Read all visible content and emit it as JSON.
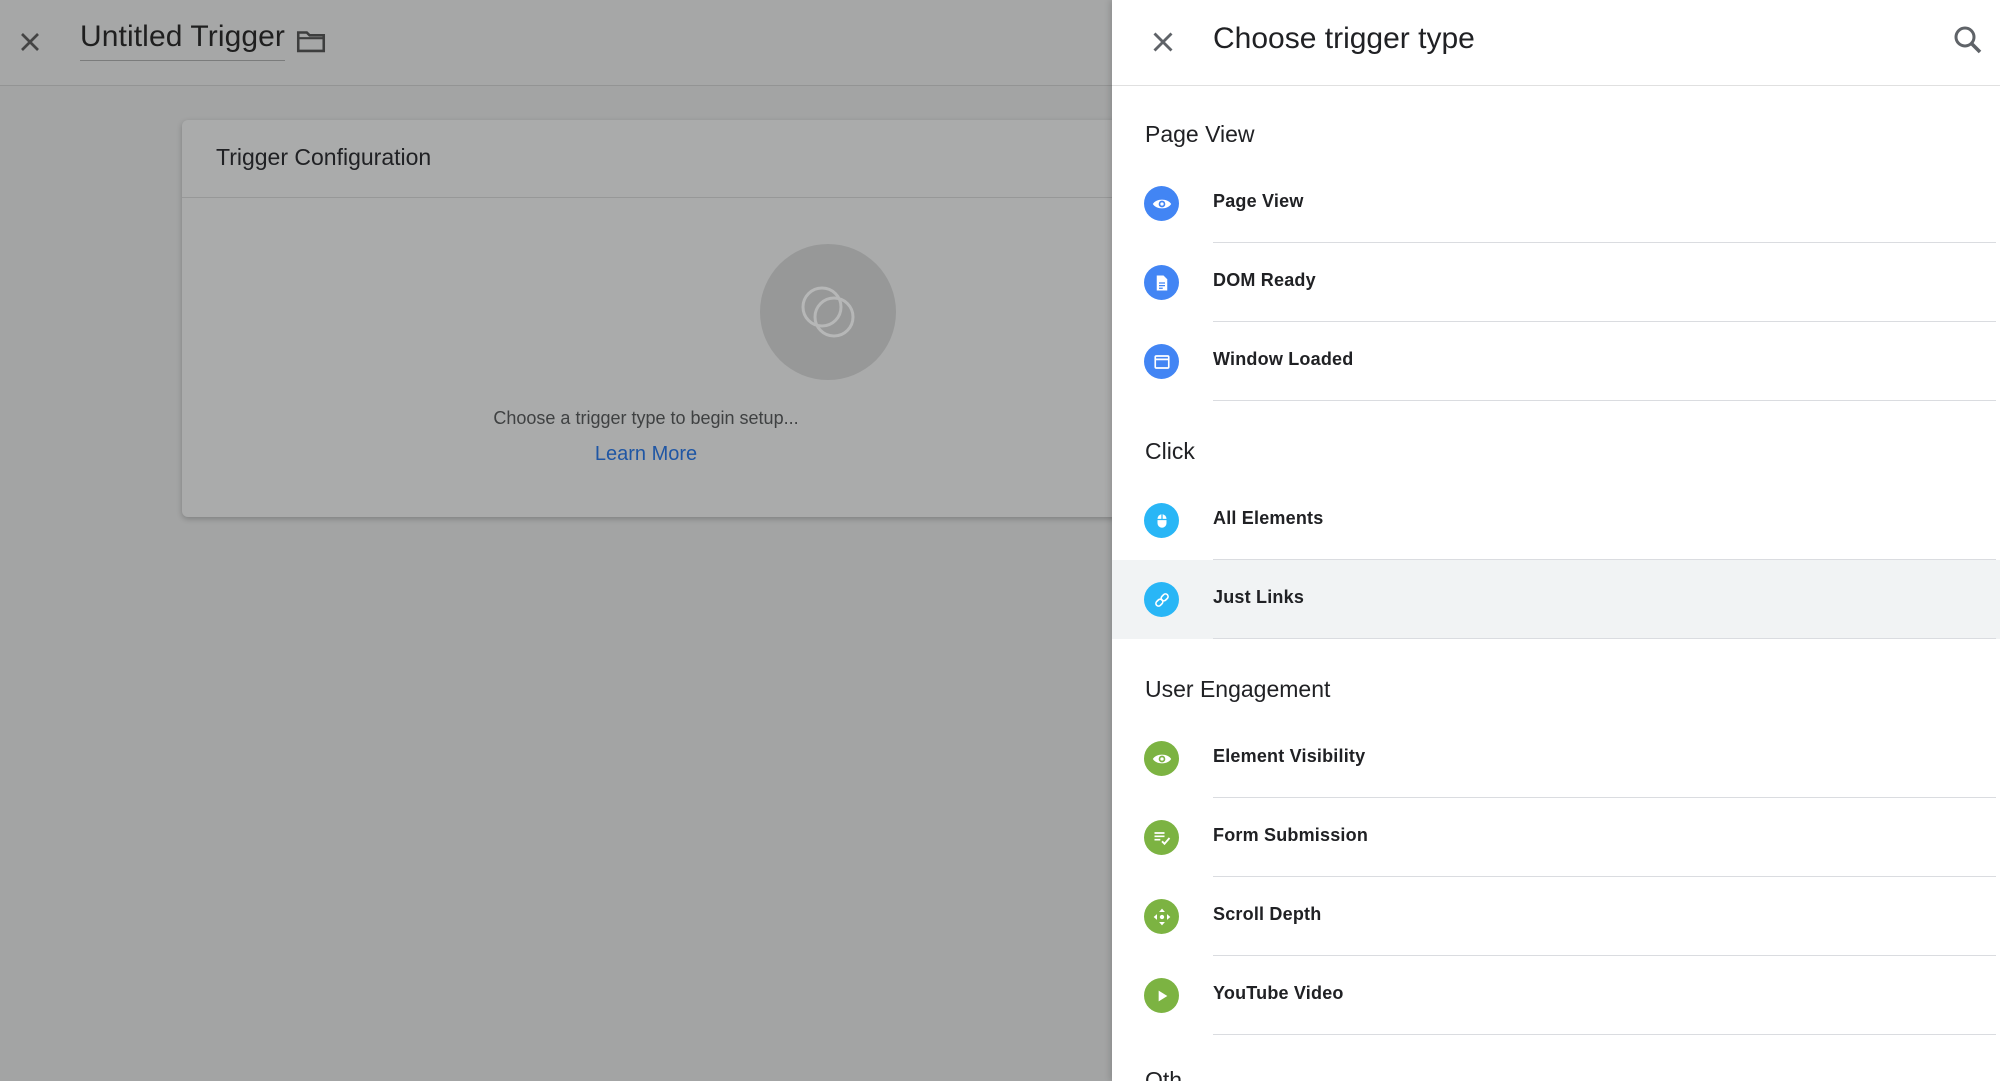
{
  "editor": {
    "title": "Untitled Trigger",
    "card_title": "Trigger Configuration",
    "placeholder_text": "Choose a trigger type to begin setup...",
    "learn_more": "Learn More"
  },
  "panel": {
    "title": "Choose trigger type",
    "sections": [
      {
        "title": "Page View",
        "items": [
          {
            "label": "Page View",
            "icon": "eye-icon",
            "color": "#4285f4"
          },
          {
            "label": "DOM Ready",
            "icon": "document-icon",
            "color": "#4285f4"
          },
          {
            "label": "Window Loaded",
            "icon": "window-icon",
            "color": "#4285f4"
          }
        ]
      },
      {
        "title": "Click",
        "items": [
          {
            "label": "All Elements",
            "icon": "mouse-icon",
            "color": "#29b6f6"
          },
          {
            "label": "Just Links",
            "icon": "link-icon",
            "color": "#29b6f6"
          }
        ]
      },
      {
        "title": "User Engagement",
        "items": [
          {
            "label": "Element Visibility",
            "icon": "eye-icon",
            "color": "#7cb342"
          },
          {
            "label": "Form Submission",
            "icon": "form-check-icon",
            "color": "#7cb342"
          },
          {
            "label": "Scroll Depth",
            "icon": "move-arrows-icon",
            "color": "#7cb342"
          },
          {
            "label": "YouTube Video",
            "icon": "play-icon",
            "color": "#7cb342"
          }
        ]
      },
      {
        "title": "Oth",
        "items": []
      }
    ]
  }
}
